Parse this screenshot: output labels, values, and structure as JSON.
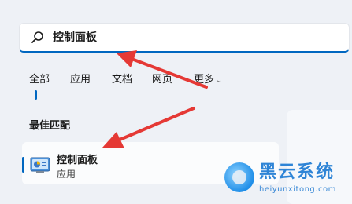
{
  "search": {
    "icon": "search-icon",
    "value": "控制面板"
  },
  "tabs": [
    {
      "label": "全部"
    },
    {
      "label": "应用"
    },
    {
      "label": "文档"
    },
    {
      "label": "网页"
    },
    {
      "label": "更多"
    }
  ],
  "best_match": {
    "section_title": "最佳匹配",
    "result": {
      "icon": "control-panel-icon",
      "title": "控制面板",
      "subtitle": "应用"
    }
  },
  "watermark": {
    "title": "黑云系统",
    "url": "heiyunxitong.com"
  },
  "colors": {
    "accent": "#0067c0",
    "arrow": "#e53935",
    "watermark": "#2e84d6"
  }
}
